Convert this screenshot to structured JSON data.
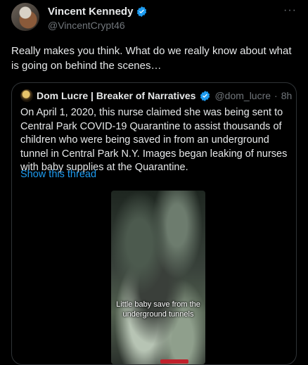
{
  "author": {
    "name": "Vincent Kennedy",
    "handle": "@VincentCrypt46",
    "verified_color": "#1d9bf0"
  },
  "more_icon": "more-horizontal-icon",
  "more_label": "···",
  "tweet": {
    "text": "Really makes you think. What do we really know about what is going on behind the scenes…"
  },
  "quoted": {
    "name": "Dom Lucre | Breaker of Narratives",
    "handle": "@dom_lucre",
    "separator": "·",
    "time": "8h",
    "text": "On April 1, 2020, this nurse claimed she was being sent to Central Park COVID-19 Quarantine to assist thousands of children who were being saved in from an underground tunnel in Central Park N.Y. Images began leaking of nurses with baby supplies at the Quarantine.",
    "show_thread": "Show this thread",
    "video_caption": "Little baby save from the underground tunnels"
  },
  "colors": {
    "background": "#000000",
    "text": "#e7e9ea",
    "secondary": "#71767b",
    "link": "#1d9bf0",
    "border": "#2f3336",
    "verified_gold": "#e8b400"
  }
}
